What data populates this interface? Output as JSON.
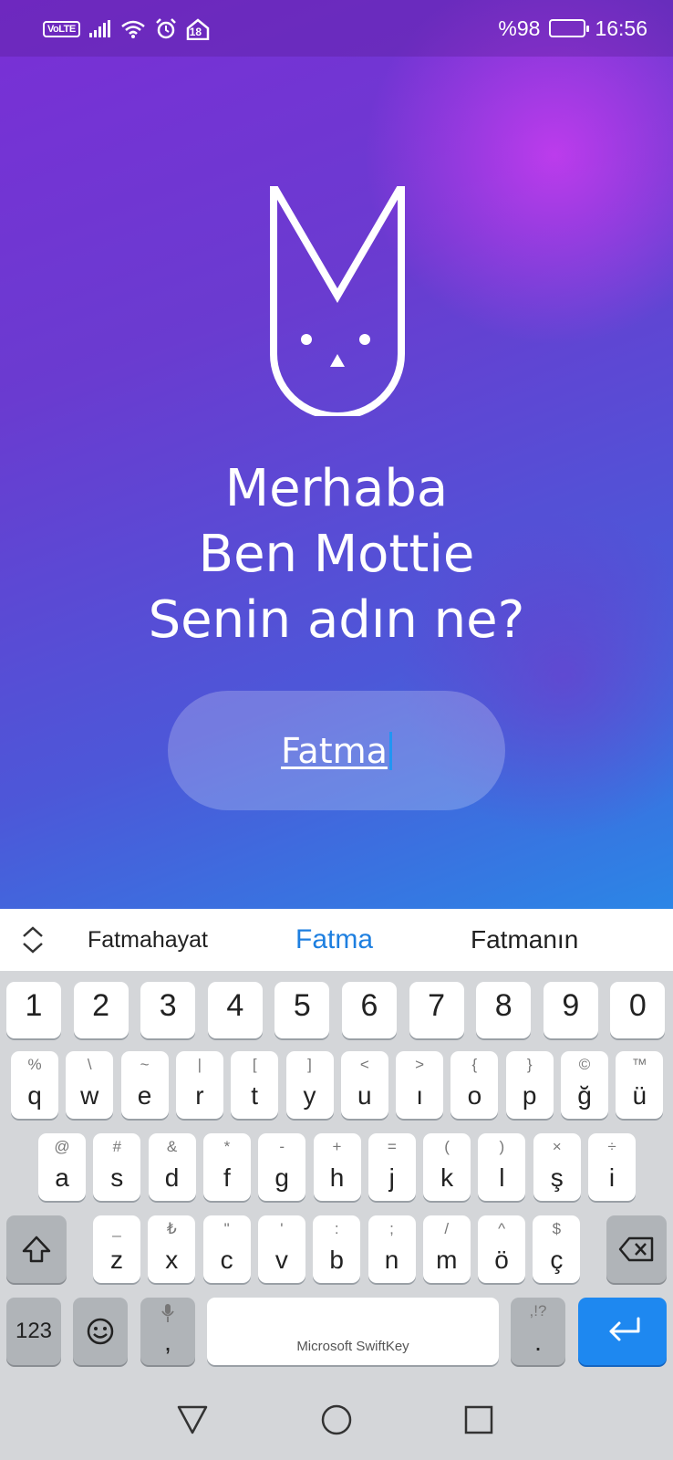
{
  "status_bar": {
    "volte": "VoLTE",
    "badge_number": "18",
    "battery_percent": "%98",
    "battery_level": 0.98,
    "time": "16:56"
  },
  "greeting": {
    "line1": "Merhaba",
    "line2": "Ben Mottie",
    "line3": "Senin adın ne?"
  },
  "name_input": {
    "value": "Fatma"
  },
  "keyboard": {
    "suggestions": [
      "Fatmahayat",
      "Fatma",
      "Fatmanın"
    ],
    "number_row": [
      "1",
      "2",
      "3",
      "4",
      "5",
      "6",
      "7",
      "8",
      "9",
      "0"
    ],
    "row1": [
      {
        "main": "q",
        "alt": "%"
      },
      {
        "main": "w",
        "alt": "\\"
      },
      {
        "main": "e",
        "alt": "~"
      },
      {
        "main": "r",
        "alt": "|"
      },
      {
        "main": "t",
        "alt": "["
      },
      {
        "main": "y",
        "alt": "]"
      },
      {
        "main": "u",
        "alt": "<"
      },
      {
        "main": "ı",
        "alt": ">"
      },
      {
        "main": "o",
        "alt": "{"
      },
      {
        "main": "p",
        "alt": "}"
      },
      {
        "main": "ğ",
        "alt": "©"
      },
      {
        "main": "ü",
        "alt": "™"
      }
    ],
    "row2": [
      {
        "main": "a",
        "alt": "@"
      },
      {
        "main": "s",
        "alt": "#"
      },
      {
        "main": "d",
        "alt": "&"
      },
      {
        "main": "f",
        "alt": "*"
      },
      {
        "main": "g",
        "alt": "-"
      },
      {
        "main": "h",
        "alt": "+"
      },
      {
        "main": "j",
        "alt": "="
      },
      {
        "main": "k",
        "alt": "("
      },
      {
        "main": "l",
        "alt": ")"
      },
      {
        "main": "ş",
        "alt": "×"
      },
      {
        "main": "i",
        "alt": "÷"
      }
    ],
    "row3": [
      {
        "main": "z",
        "alt": "_"
      },
      {
        "main": "x",
        "alt": "₺"
      },
      {
        "main": "c",
        "alt": "\""
      },
      {
        "main": "v",
        "alt": "'"
      },
      {
        "main": "b",
        "alt": ":"
      },
      {
        "main": "n",
        "alt": ";"
      },
      {
        "main": "m",
        "alt": "/"
      },
      {
        "main": "ö",
        "alt": "^"
      },
      {
        "main": "ç",
        "alt": "$"
      }
    ],
    "symbols_key": "123",
    "comma_key": ",",
    "period_key": ".",
    "period_alt": ",!?",
    "space_label": "Microsoft SwiftKey",
    "icons": {
      "shift": "shift-icon",
      "backspace": "backspace-icon",
      "emoji": "emoji-icon",
      "mic": "microphone-icon",
      "enter": "enter-icon",
      "suggestion_toggle": "expand-collapse-icon"
    }
  },
  "colors": {
    "accent": "#1e88f0",
    "suggestion_highlight": "#1e7fe0",
    "gradient_top": "#7a2fd6",
    "gradient_bottom": "#2b86e6"
  }
}
